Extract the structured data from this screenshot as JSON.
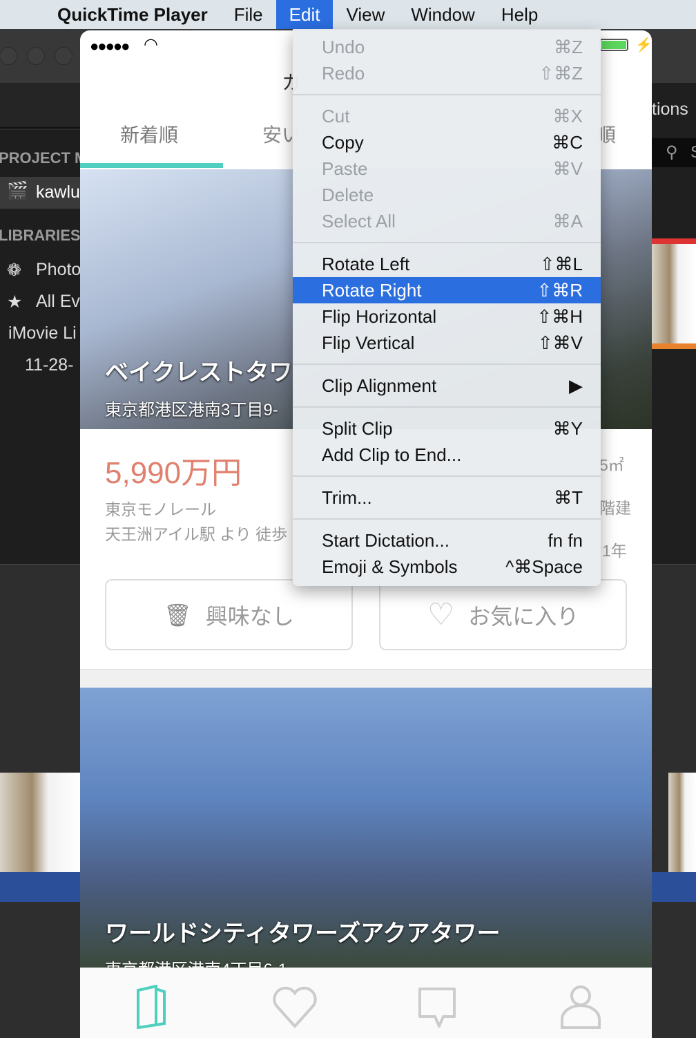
{
  "menubar": {
    "app": "QuickTime Player",
    "items": [
      "File",
      "Edit",
      "View",
      "Window",
      "Help"
    ],
    "active": "Edit"
  },
  "imovie": {
    "project_header": "PROJECT M",
    "project_item": "kawlu",
    "libraries_header": "LIBRARIES",
    "photos": "Photo",
    "all_events": "All Ev",
    "library": "iMovie Li",
    "event": "11-28-",
    "right_title": "tions",
    "search_placeholder": "S"
  },
  "phone": {
    "status": {
      "signal": "●●●●●"
    },
    "nav_title": "カ",
    "tabs": [
      "新着順",
      "安い",
      "順"
    ],
    "listing1": {
      "title": "ベイクレストタワ",
      "address": "東京都港区港南3丁目9-",
      "price": "5,990万円",
      "line": "東京モノレール",
      "station": "天王洲アイル駅 より 徒歩",
      "area": "5㎡",
      "floors": "階建",
      "age": "1年"
    },
    "buttons": {
      "not_interested": "興味なし",
      "favorite": "お気に入り"
    },
    "listing2": {
      "title": "ワールドシティタワーズアクアタワー",
      "address": "東京都港区港南4丁目6-1"
    },
    "accent": "#4fcfbf",
    "price_color": "#e0806e"
  },
  "edit_menu": {
    "groups": [
      [
        {
          "label": "Undo",
          "shortcut": "⌘Z",
          "disabled": true
        },
        {
          "label": "Redo",
          "shortcut": "⇧⌘Z",
          "disabled": true
        }
      ],
      [
        {
          "label": "Cut",
          "shortcut": "⌘X",
          "disabled": true
        },
        {
          "label": "Copy",
          "shortcut": "⌘C"
        },
        {
          "label": "Paste",
          "shortcut": "⌘V",
          "disabled": true
        },
        {
          "label": "Delete",
          "shortcut": "",
          "disabled": true
        },
        {
          "label": "Select All",
          "shortcut": "⌘A",
          "disabled": true
        }
      ],
      [
        {
          "label": "Rotate Left",
          "shortcut": "⇧⌘L"
        },
        {
          "label": "Rotate Right",
          "shortcut": "⇧⌘R",
          "highlighted": true
        },
        {
          "label": "Flip Horizontal",
          "shortcut": "⇧⌘H"
        },
        {
          "label": "Flip Vertical",
          "shortcut": "⇧⌘V"
        }
      ],
      [
        {
          "label": "Clip Alignment",
          "shortcut": "▶"
        }
      ],
      [
        {
          "label": "Split Clip",
          "shortcut": "⌘Y"
        },
        {
          "label": "Add Clip to End...",
          "shortcut": ""
        }
      ],
      [
        {
          "label": "Trim...",
          "shortcut": "⌘T"
        }
      ],
      [
        {
          "label": "Start Dictation...",
          "shortcut": "fn fn"
        },
        {
          "label": "Emoji & Symbols",
          "shortcut": "^⌘Space"
        }
      ]
    ]
  }
}
